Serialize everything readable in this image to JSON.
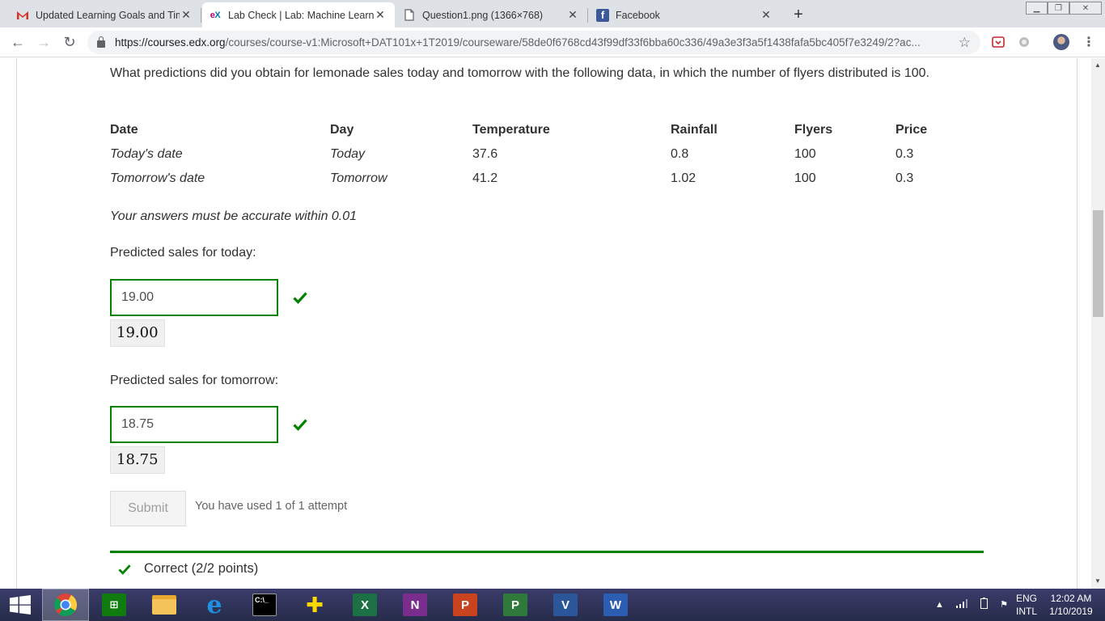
{
  "browser": {
    "tabs": [
      {
        "title": "Updated Learning Goals and Tim",
        "icon": "gmail-icon",
        "active": false
      },
      {
        "title": "Lab Check | Lab: Machine Learnin",
        "icon": "edx-icon",
        "active": true
      },
      {
        "title": "Question1.png (1366×768)",
        "icon": "file-icon",
        "active": false
      },
      {
        "title": "Facebook",
        "icon": "facebook-icon",
        "active": false
      }
    ],
    "new_tab": "+",
    "url_host": "https://courses.edx.org",
    "url_path": "/courses/course-v1:Microsoft+DAT101x+1T2019/courseware/58de0f6768cd43f99df33f6bba60c336/49a3e3f3a5f1438fafa5bc405f7e3249/2?ac..."
  },
  "problem": {
    "question": "What predictions did you obtain for lemonade sales today and tomorrow with the following data, in which the number of flyers distributed is 100.",
    "table": {
      "headers": [
        "Date",
        "Day",
        "Temperature",
        "Rainfall",
        "Flyers",
        "Price"
      ],
      "rows": [
        [
          "Today's date",
          "Today",
          "37.6",
          "0.8",
          "100",
          "0.3"
        ],
        [
          "Tomorrow's date",
          "Tomorrow",
          "41.2",
          "1.02",
          "100",
          "0.3"
        ]
      ]
    },
    "accuracy_note": "Your answers must be accurate within 0.01",
    "today_label": "Predicted sales for today:",
    "today_value": "19.00",
    "today_preview": "19.00",
    "tomorrow_label": "Predicted sales for tomorrow:",
    "tomorrow_value": "18.75",
    "tomorrow_preview": "18.75",
    "submit_label": "Submit",
    "attempts_text": "You have used 1 of 1 attempt",
    "result_text": "Correct (2/2 points)",
    "correct_color": "#008100"
  },
  "taskbar": {
    "apps": [
      "windows-start",
      "chrome",
      "store",
      "file-explorer",
      "internet-explorer",
      "command-prompt",
      "app-plus",
      "excel",
      "onenote",
      "powerpoint",
      "project",
      "visio",
      "word"
    ],
    "lang_top": "ENG",
    "lang_bottom": "INTL",
    "time": "12:02 AM",
    "date": "1/10/2019"
  }
}
